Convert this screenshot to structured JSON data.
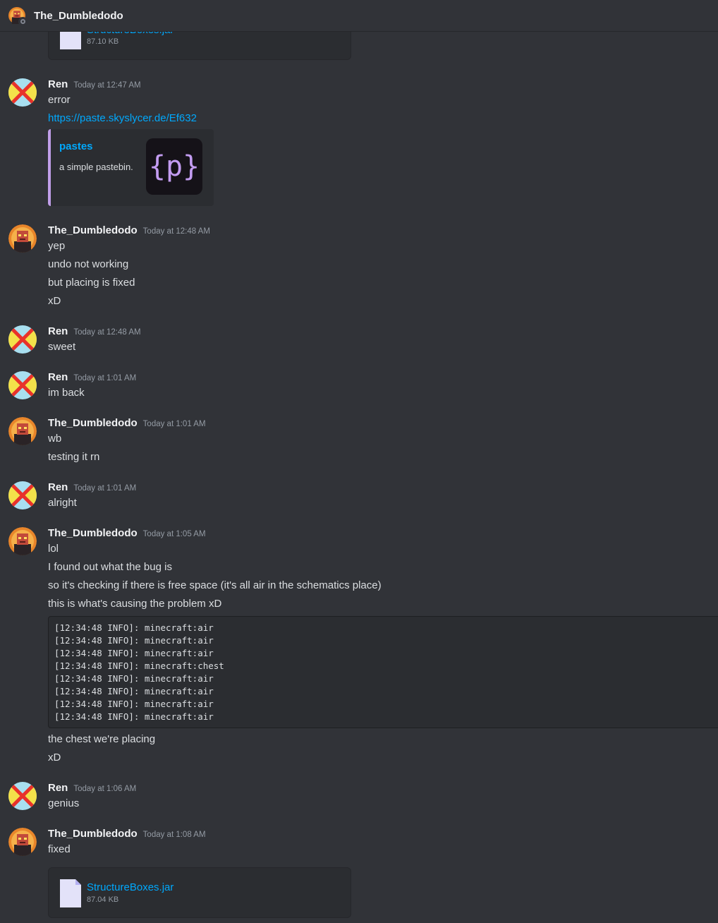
{
  "header": {
    "title": "The_Dumbledodo",
    "avatar_icon": "dodo-avatar-icon",
    "status_icon": "offline-status-icon"
  },
  "attachment_top": {
    "name": "StructureBoxes.jar",
    "size": "87.10 KB"
  },
  "messages": [
    {
      "author": "Ren",
      "time": "Today at 12:47 AM",
      "lines": [
        "error"
      ],
      "link": "https://paste.skyslycer.de/Ef632",
      "embed": {
        "title": "pastes",
        "description": "a simple pastebin.",
        "thumb_text": "{p}"
      }
    },
    {
      "author": "The_Dumbledodo",
      "time": "Today at 12:48 AM",
      "lines": [
        "yep",
        "undo not working",
        "but placing is fixed",
        "xD"
      ]
    },
    {
      "author": "Ren",
      "time": "Today at 12:48 AM",
      "lines": [
        "sweet"
      ]
    },
    {
      "author": "Ren",
      "time": "Today at 1:01 AM",
      "lines": [
        "im back"
      ]
    },
    {
      "author": "The_Dumbledodo",
      "time": "Today at 1:01 AM",
      "lines": [
        "wb",
        "testing it rn"
      ]
    },
    {
      "author": "Ren",
      "time": "Today at 1:01 AM",
      "lines": [
        "alright"
      ]
    },
    {
      "author": "The_Dumbledodo",
      "time": "Today at 1:05 AM",
      "lines": [
        "lol",
        "I found out what the bug is",
        "so it's checking if there is free space (it's all air in the schematics place)",
        "this is what's causing the problem xD"
      ],
      "code": [
        "[12:34:48 INFO]: minecraft:air",
        "[12:34:48 INFO]: minecraft:air",
        "[12:34:48 INFO]: minecraft:air",
        "[12:34:48 INFO]: minecraft:chest",
        "[12:34:48 INFO]: minecraft:air",
        "[12:34:48 INFO]: minecraft:air",
        "[12:34:48 INFO]: minecraft:air",
        "[12:34:48 INFO]: minecraft:air"
      ],
      "after_lines": [
        "the chest we're placing",
        "xD"
      ]
    },
    {
      "author": "Ren",
      "time": "Today at 1:06 AM",
      "lines": [
        "genius"
      ]
    },
    {
      "author": "The_Dumbledodo",
      "time": "Today at 1:08 AM",
      "lines": [
        "fixed"
      ],
      "attachment": {
        "name": "StructureBoxes.jar",
        "size": "87.04 KB"
      }
    }
  ]
}
